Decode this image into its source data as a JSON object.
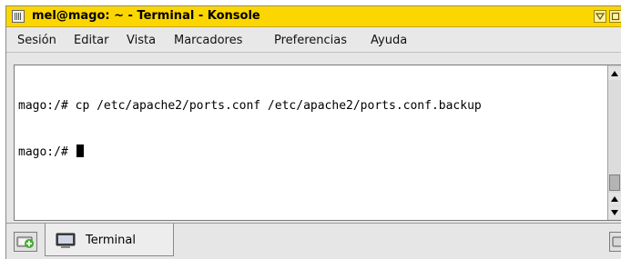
{
  "window": {
    "title": "mel@mago: ~ - Terminal - Konsole",
    "accent_color": "#fcd600"
  },
  "menubar": {
    "items": [
      {
        "label": "Sesión"
      },
      {
        "label": "Editar"
      },
      {
        "label": "Vista"
      },
      {
        "label": "Marcadores"
      },
      {
        "label": "Preferencias"
      },
      {
        "label": "Ayuda"
      }
    ]
  },
  "terminal": {
    "lines": [
      "mago:/# cp /etc/apache2/ports.conf /etc/apache2/ports.conf.backup",
      "mago:/# "
    ]
  },
  "tabs": [
    {
      "label": "Terminal",
      "icon": "terminal-icon"
    }
  ],
  "icons": {
    "app": "konsole-app-icon",
    "minimize": "minimize-icon",
    "maximize": "maximize-icon",
    "close": "close-icon",
    "new_session": "new-session-icon",
    "close_session": "close-session-icon"
  }
}
